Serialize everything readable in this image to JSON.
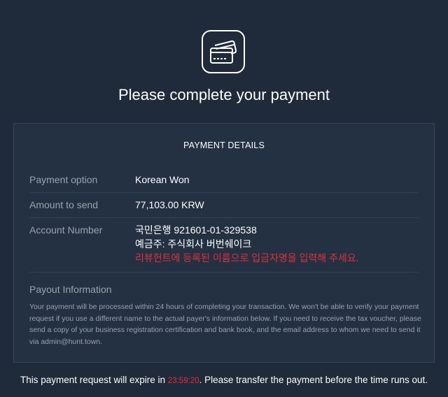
{
  "page": {
    "icon": "credit-card-icon",
    "title": "Please complete your payment"
  },
  "details": {
    "heading": "PAYMENT DETAILS",
    "payment_option": {
      "label": "Payment option",
      "value": "Korean Won"
    },
    "amount": {
      "label": "Amount to send",
      "value": "77,103.00 KRW"
    },
    "account": {
      "label": "Account Number",
      "line1": "국민은행 921601-01-329538",
      "line2": "예금주: 주식회사 버번쉐이크",
      "warning": "리뷰헌트에 등록된 이름으로 입금자명을 입력해 주세요."
    },
    "payout": {
      "title": "Payout Information",
      "text": "Your payment will be processed within 24 hours of completing your transaction. We won't be able to verify your payment request if you use a different name to the actual payer's information below. If you need to receive the tax voucher, please send a copy of your business registration certification and bank book, and the email address to whom we need to send it via admin@hunt.town."
    }
  },
  "footer": {
    "prefix": "This payment request will expire in ",
    "timer": "23:59:20",
    "suffix": ". Please transfer the payment before the time runs out."
  },
  "colors": {
    "background": "#1f2a3a",
    "panel": "#243142",
    "warning": "#e0303a",
    "muted_text": "#9aa3ae"
  }
}
